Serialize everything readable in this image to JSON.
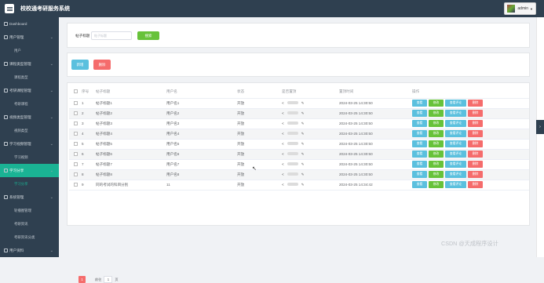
{
  "app": {
    "title": "校校通考研服务系统",
    "user": "admin"
  },
  "sidebar": {
    "items": [
      {
        "label": "Dashboard",
        "type": "top",
        "chevron": false
      },
      {
        "label": "用户管理",
        "type": "group",
        "chevron": true
      },
      {
        "label": "用户",
        "type": "sub"
      },
      {
        "label": "课程类型管理",
        "type": "group",
        "chevron": true
      },
      {
        "label": "课程类型",
        "type": "sub"
      },
      {
        "label": "考研课程管理",
        "type": "group",
        "chevron": true
      },
      {
        "label": "考研课程",
        "type": "sub"
      },
      {
        "label": "视频类型管理",
        "type": "group",
        "chevron": true
      },
      {
        "label": "视频类型",
        "type": "sub"
      },
      {
        "label": "学习视频管理",
        "type": "group",
        "chevron": true
      },
      {
        "label": "学习视频",
        "type": "sub"
      },
      {
        "label": "学习分享",
        "type": "group",
        "chevron": true,
        "active": true
      },
      {
        "label": "学习分享",
        "type": "sub",
        "active": true
      },
      {
        "label": "系统管理",
        "type": "group",
        "chevron": true
      },
      {
        "label": "轮播图管理",
        "type": "sub"
      },
      {
        "label": "考研资讯",
        "type": "sub"
      },
      {
        "label": "考研资讯分类",
        "type": "sub"
      },
      {
        "label": "用户资料",
        "type": "group",
        "chevron": true
      }
    ]
  },
  "search": {
    "label": "帖子标题",
    "placeholder": "帖子标题",
    "button": "搜索"
  },
  "actions": {
    "add": "新增",
    "delete": "删除"
  },
  "table": {
    "headers": [
      "序号",
      "帖子标题",
      "用户名",
      "状态",
      "是否置顶",
      "置顶时间",
      "操作"
    ],
    "rows": [
      {
        "no": "1",
        "title": "帖子标题1",
        "user": "用户名1",
        "status": "开放",
        "time": "2024-03-25 14:30:50"
      },
      {
        "no": "2",
        "title": "帖子标题2",
        "user": "用户名2",
        "status": "开放",
        "time": "2024-03-25 14:30:50"
      },
      {
        "no": "3",
        "title": "帖子标题3",
        "user": "用户名3",
        "status": "开放",
        "time": "2024-03-25 14:30:50"
      },
      {
        "no": "4",
        "title": "帖子标题4",
        "user": "用户名4",
        "status": "开放",
        "time": "2024-03-25 14:30:50"
      },
      {
        "no": "5",
        "title": "帖子标题5",
        "user": "用户名5",
        "status": "开放",
        "time": "2024-03-25 14:30:50"
      },
      {
        "no": "6",
        "title": "帖子标题6",
        "user": "用户名6",
        "status": "开放",
        "time": "2024-03-25 14:30:50"
      },
      {
        "no": "7",
        "title": "帖子标题7",
        "user": "用户名7",
        "status": "开放",
        "time": "2024-03-25 14:30:50"
      },
      {
        "no": "8",
        "title": "帖子标题8",
        "user": "用户名8",
        "status": "开放",
        "time": "2024-03-25 14:30:50"
      },
      {
        "no": "9",
        "title": "同的考试的科目分别",
        "user": "11",
        "status": "开放",
        "time": "2024-03-25 14:34:42"
      }
    ],
    "row_actions": {
      "view": "查看",
      "edit": "修改",
      "comments": "查看评论",
      "delete": "删除"
    }
  },
  "pagination": {
    "current": "1",
    "goto_prefix": "前往",
    "goto_value": "1",
    "goto_suffix": "页"
  },
  "watermark": "CSDN @天成程序设计",
  "colors": {
    "sidebar": "#2f4050",
    "accent": "#1ab394",
    "search": "#67c23a",
    "info": "#5bc0de",
    "danger": "#f56c6c"
  },
  "icons": {
    "menu": "menu-icon",
    "share": "share-icon",
    "edit": "pencil-icon",
    "collapse": "chevron-right-icon"
  }
}
